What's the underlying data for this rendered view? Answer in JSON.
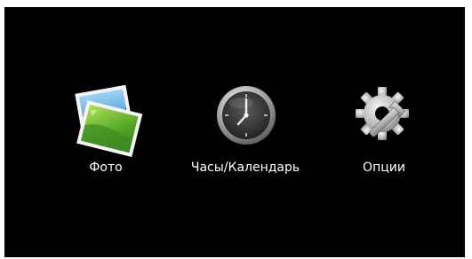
{
  "menu": {
    "items": [
      {
        "label": "Фото",
        "icon": "photo-icon"
      },
      {
        "label": "Часы/Календарь",
        "icon": "clock-icon"
      },
      {
        "label": "Опции",
        "icon": "gear-wrench-icon"
      }
    ]
  },
  "colors": {
    "background": "#000000",
    "text": "#ffffff",
    "frame": "#ffffff"
  }
}
